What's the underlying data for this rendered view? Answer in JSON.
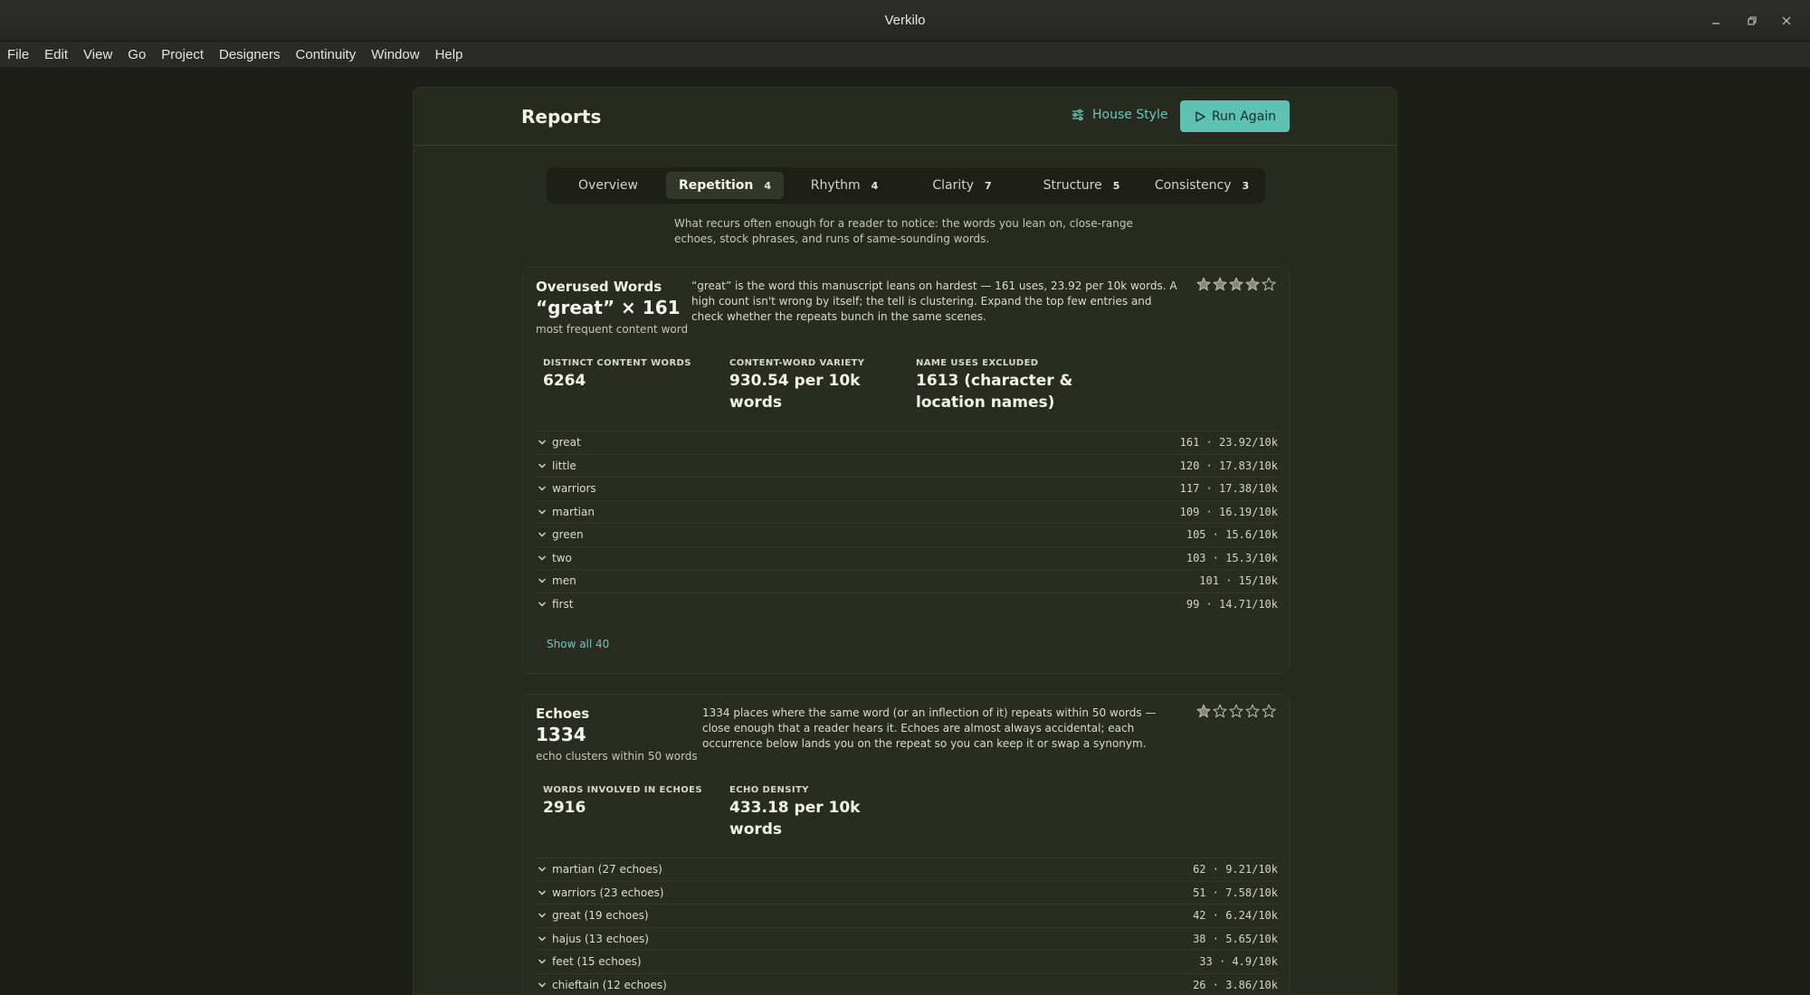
{
  "window": {
    "title": "Verkilo"
  },
  "menu": [
    "File",
    "Edit",
    "View",
    "Go",
    "Project",
    "Designers",
    "Continuity",
    "Window",
    "Help"
  ],
  "header": {
    "title": "Reports",
    "house_style_label": "House Style",
    "run_again_label": "Run Again"
  },
  "tabs": [
    {
      "label": "Overview",
      "count": ""
    },
    {
      "label": "Repetition",
      "count": "4"
    },
    {
      "label": "Rhythm",
      "count": "4"
    },
    {
      "label": "Clarity",
      "count": "7"
    },
    {
      "label": "Structure",
      "count": "5"
    },
    {
      "label": "Consistency",
      "count": "3"
    }
  ],
  "intro": "What recurs often enough for a reader to notice: the words you lean on, close-range echoes, stock phrases, and runs of same-sounding words.",
  "cards": [
    {
      "name": "Overused Words",
      "value": "“great” × 161",
      "sub": "most frequent content word",
      "desc": "“great” is the word this manuscript leans on hardest — 161 uses, 23.92 per 10k words. A high count isn't wrong by itself; the tell is clustering. Expand the top few entries and check whether the repeats bunch in the same scenes.",
      "rating": 4,
      "metrics": [
        {
          "label": "DISTINCT CONTENT WORDS",
          "value": "6264"
        },
        {
          "label": "CONTENT-WORD VARIETY",
          "value": "930.54 per 10k words"
        },
        {
          "label": "NAME USES EXCLUDED",
          "value": "1613 (character & location names)"
        }
      ],
      "rows": [
        {
          "label": "great",
          "value": "161 · 23.92/10k"
        },
        {
          "label": "little",
          "value": "120 · 17.83/10k"
        },
        {
          "label": "warriors",
          "value": "117 · 17.38/10k"
        },
        {
          "label": "martian",
          "value": "109 · 16.19/10k"
        },
        {
          "label": "green",
          "value": "105 · 15.6/10k"
        },
        {
          "label": "two",
          "value": "103 · 15.3/10k"
        },
        {
          "label": "men",
          "value": "101 · 15/10k"
        },
        {
          "label": "first",
          "value": "99 · 14.71/10k"
        }
      ],
      "show_all": "Show all 40"
    },
    {
      "name": "Echoes",
      "value": "1334",
      "sub": "echo clusters within 50 words",
      "desc": "1334 places where the same word (or an inflection of it) repeats within 50 words — close enough that a reader hears it. Echoes are almost always accidental; each occurrence below lands you on the repeat so you can keep it or swap a synonym.",
      "rating": 1,
      "metrics": [
        {
          "label": "WORDS INVOLVED IN ECHOES",
          "value": "2916"
        },
        {
          "label": "ECHO DENSITY",
          "value": "433.18 per 10k words"
        }
      ],
      "rows": [
        {
          "label": "martian (27 echoes)",
          "value": "62 · 9.21/10k"
        },
        {
          "label": "warriors (23 echoes)",
          "value": "51 · 7.58/10k"
        },
        {
          "label": "great (19 echoes)",
          "value": "42 · 6.24/10k"
        },
        {
          "label": "hajus (13 echoes)",
          "value": "38 · 5.65/10k"
        },
        {
          "label": "feet (15 echoes)",
          "value": "33 · 4.9/10k"
        },
        {
          "label": "chieftain (12 echoes)",
          "value": "26 · 3.86/10k"
        }
      ]
    }
  ]
}
